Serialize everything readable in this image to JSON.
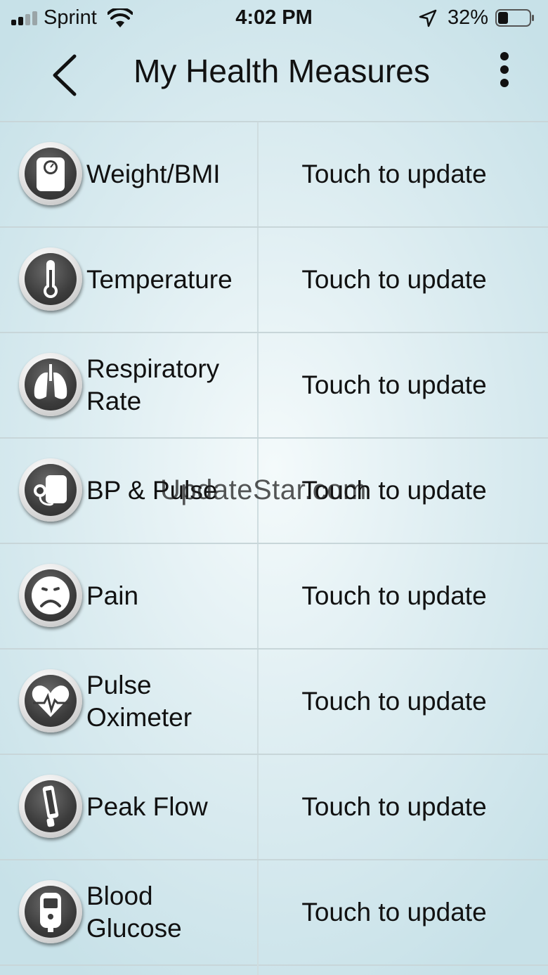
{
  "status_bar": {
    "carrier": "Sprint",
    "time": "4:02 PM",
    "battery_percent": "32%",
    "battery_level": 0.32,
    "signal_bars": 2,
    "signal_icon": "cellular-signal-icon",
    "wifi_icon": "wifi-icon",
    "location_icon": "location-arrow-icon",
    "battery_icon": "battery-icon"
  },
  "nav": {
    "title": "My Health Measures",
    "back_icon": "chevron-left-icon",
    "more_icon": "vertical-ellipsis-icon"
  },
  "measures": [
    {
      "label": "Weight/BMI",
      "action": "Touch to update",
      "icon": "scale-icon"
    },
    {
      "label": "Temperature",
      "action": "Touch to update",
      "icon": "thermometer-icon"
    },
    {
      "label": "Respiratory Rate",
      "action": "Touch to update",
      "icon": "lungs-icon"
    },
    {
      "label": "BP & Pulse",
      "action": "Touch to update",
      "icon": "blood-pressure-cuff-icon"
    },
    {
      "label": "Pain",
      "action": "Touch to update",
      "icon": "sad-face-icon"
    },
    {
      "label": "Pulse Oximeter",
      "action": "Touch to update",
      "icon": "heart-pulse-icon"
    },
    {
      "label": "Peak Flow",
      "action": "Touch to update",
      "icon": "peak-flow-meter-icon"
    },
    {
      "label": "Blood Glucose",
      "action": "Touch to update",
      "icon": "glucometer-icon"
    }
  ],
  "watermark": "UpdateStar.com",
  "colors": {
    "background": "#d7eaef",
    "text": "#111111",
    "row_divider": "#c8d6d9",
    "icon_dark": "#3c3c3c",
    "icon_light": "#ffffff"
  }
}
